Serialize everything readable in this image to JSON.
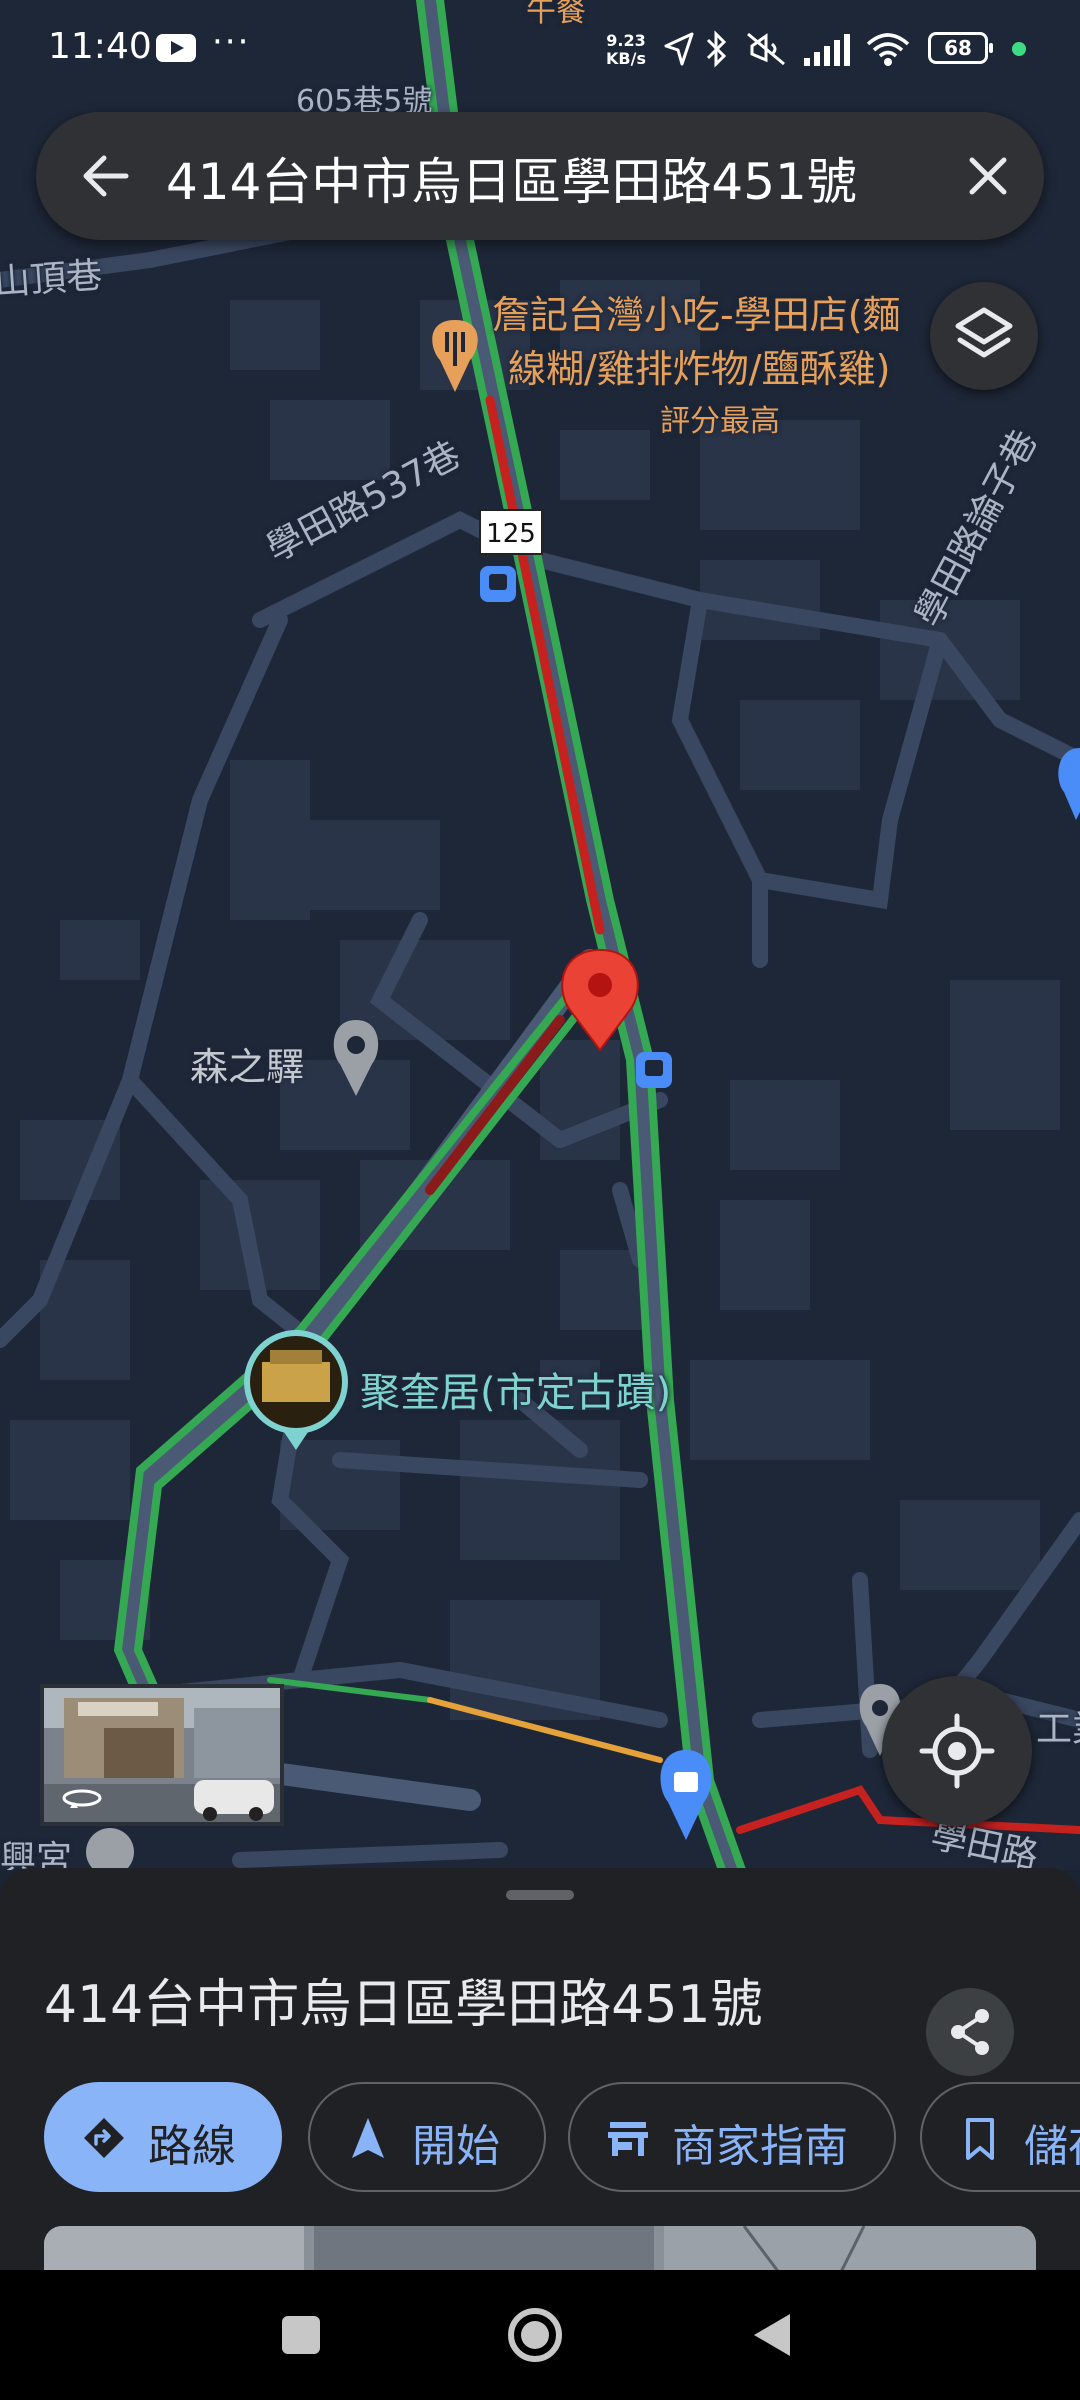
{
  "status_bar": {
    "time": "11:40",
    "dots": "···",
    "speed_value": "9.23",
    "speed_unit": "KB/s",
    "battery": "68"
  },
  "search": {
    "query": "414台中市烏日區學田路451號"
  },
  "map": {
    "street_labels": {
      "top_lane": "605巷5號",
      "top_meal": "午餐",
      "shanding": "山頂巷",
      "xuetian_537": "學田路537巷",
      "xuetian_lunzi": "學田路論子巷",
      "xuetian_bottom": "學田路",
      "industry": "工業",
      "xing_temple": "興宮"
    },
    "route_shield": "125",
    "poi_restaurant": {
      "name_line1": "詹記台灣小吃-學田店(麵",
      "name_line2": "線糊/雞排炸物/鹽酥雞)",
      "badge": "評分最高"
    },
    "poi_senzhiyi": "森之驛",
    "poi_heritage": "聚奎居(市定古蹟)",
    "colors": {
      "route_green": "#34a853",
      "route_red": "#c5221f",
      "pin_red": "#ea4335",
      "bus_blue": "#4a8df8"
    }
  },
  "icons": {
    "back": "arrow-left-icon",
    "clear": "close-icon",
    "layers": "layers-icon",
    "locate": "my-location-icon",
    "share": "share-icon",
    "street_view": "360-view-icon"
  },
  "sheet": {
    "title": "414台中市烏日區學田路451號",
    "chips": {
      "route": "路線",
      "start": "開始",
      "directory": "商家指南",
      "save": "儲存"
    }
  }
}
